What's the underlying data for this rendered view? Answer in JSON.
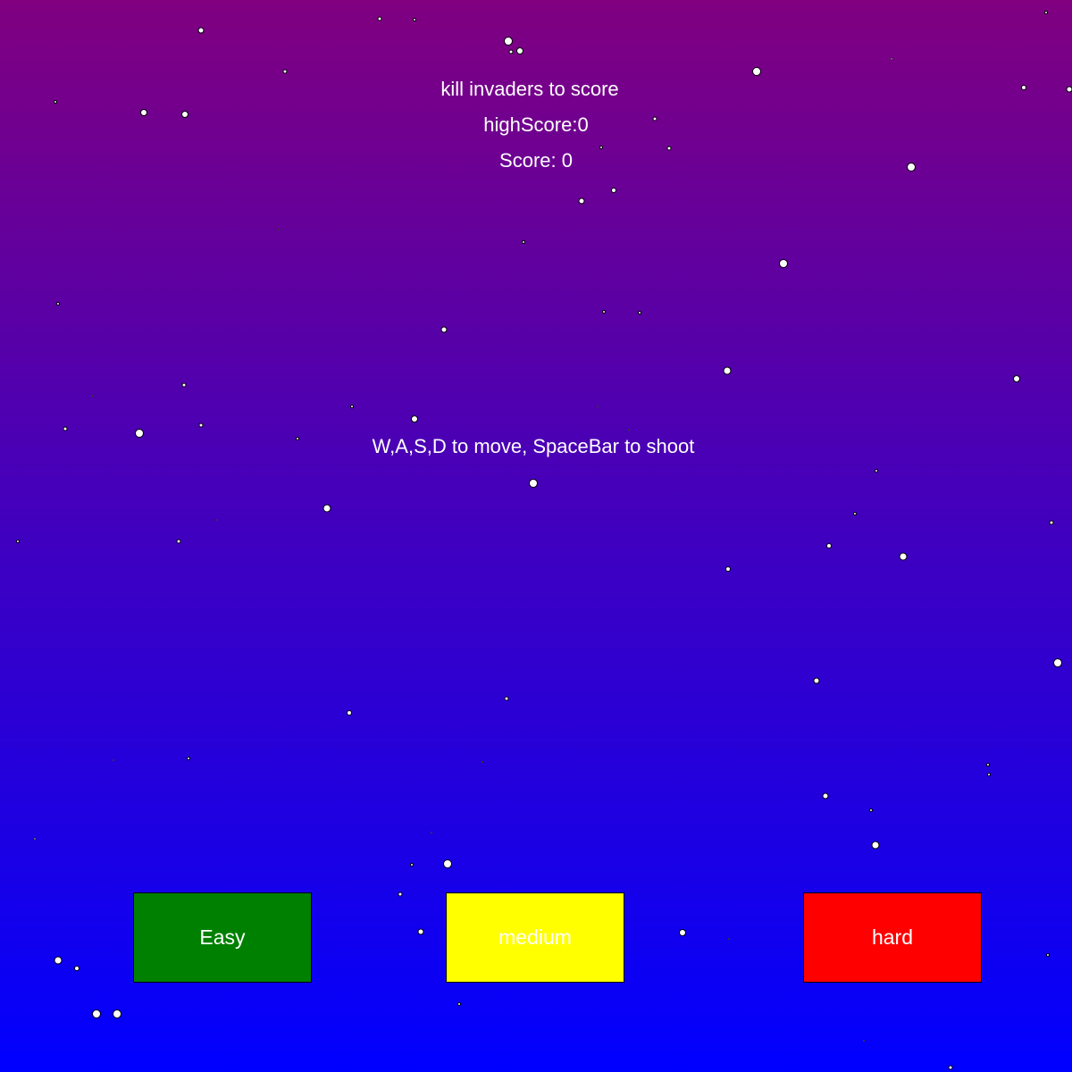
{
  "hud": {
    "objective": "kill invaders to score",
    "high_score": "highScore:0",
    "score": "Score: 0",
    "instructions": "W,A,S,D to move, SpaceBar to shoot"
  },
  "difficulty": {
    "easy": {
      "label": "Easy",
      "color": "#008000"
    },
    "medium": {
      "label": "medium",
      "color": "#ffff00"
    },
    "hard": {
      "label": "hard",
      "color": "#ff0000"
    }
  },
  "colors": {
    "background_top": "#800080",
    "background_bottom": "#0000ff",
    "text": "#ffffff",
    "star_fill": "#ffffff",
    "star_outline": "#000000"
  }
}
